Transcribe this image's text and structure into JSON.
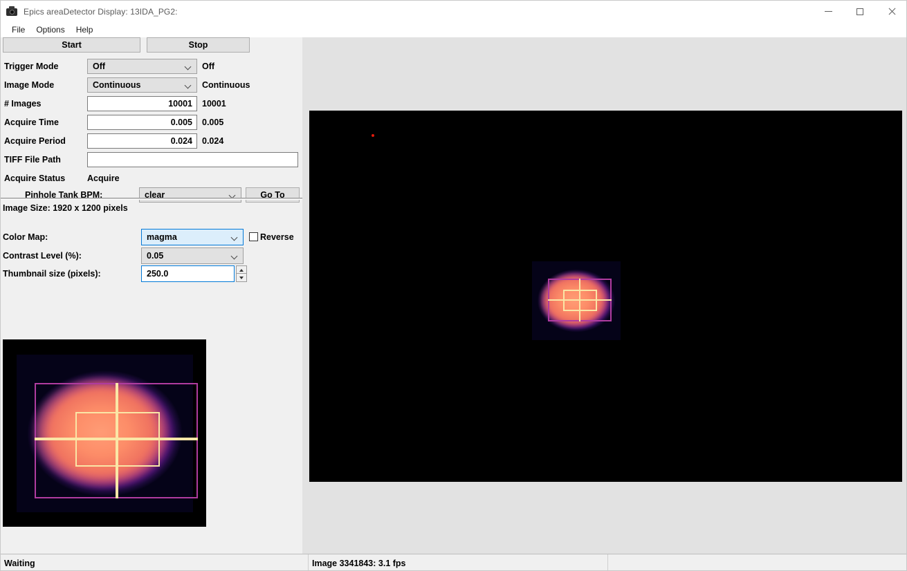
{
  "window": {
    "title": "Epics areaDetector Display: 13IDA_PG2:",
    "icon": "camera-icon",
    "minimize": "—",
    "maximize": "□",
    "close": "✕"
  },
  "menubar": {
    "items": [
      {
        "label": "File"
      },
      {
        "label": "Options"
      },
      {
        "label": "Help"
      }
    ]
  },
  "controls": {
    "start_label": "Start",
    "stop_label": "Stop",
    "rows": [
      {
        "label": "Trigger Mode",
        "widget": "combo",
        "value": "Off",
        "echo": "Off"
      },
      {
        "label": "Image Mode",
        "widget": "combo",
        "value": "Continuous",
        "echo": "Continuous"
      },
      {
        "label": "# Images",
        "widget": "text",
        "value": "10001",
        "echo": "10001"
      },
      {
        "label": "Acquire Time",
        "widget": "text",
        "value": "0.005",
        "echo": "0.005"
      },
      {
        "label": "Acquire Period",
        "widget": "text",
        "value": "0.024",
        "echo": "0.024"
      }
    ],
    "tiff_label": "TIFF File Path",
    "tiff_value": "",
    "acquire_status_label": "Acquire Status",
    "acquire_status_value": "Acquire",
    "bpm_label": "Pinhole Tank BPM:",
    "bpm_value": "clear",
    "goto_label": "Go To"
  },
  "display": {
    "image_size": "Image Size: 1920 x 1200 pixels",
    "colormap_label": "Color Map:",
    "colormap_value": "magma",
    "reverse_label": "Reverse",
    "reverse_checked": false,
    "contrast_label": "Contrast Level (%):",
    "contrast_value": "0.05",
    "thumbnail_label": "Thumbnail size (pixels):",
    "thumbnail_value": "250.0"
  },
  "statusbar": {
    "left": "Waiting",
    "middle": "Image 3341843: 3.1 fps",
    "right": ""
  },
  "colors": {
    "accent": "#0078d7",
    "panel_bg": "#f0f0f0",
    "right_bg": "#e2e2e2",
    "roi_outer": "#b03ca0",
    "roi_inner": "#fae6a6",
    "crosshair": "#fae6a6",
    "hot_pixel": "#e01b0c",
    "image_bg": "#000000"
  }
}
